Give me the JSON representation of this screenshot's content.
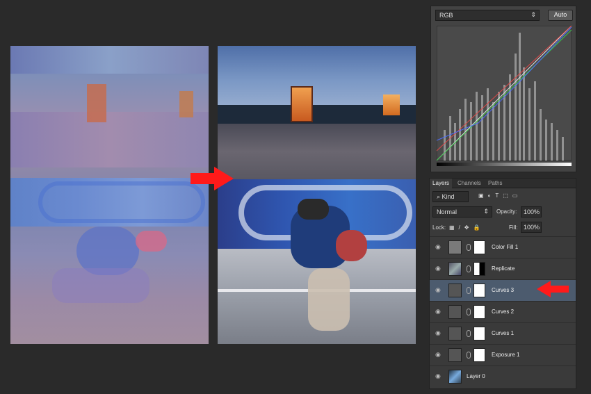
{
  "curves_panel": {
    "channel_value": "RGB",
    "auto_label": "Auto"
  },
  "layers_panel": {
    "tabs": [
      {
        "label": "Layers"
      },
      {
        "label": "Channels"
      },
      {
        "label": "Paths"
      }
    ],
    "filter_kind": "Kind",
    "blend_mode": "Normal",
    "opacity_label": "Opacity:",
    "opacity_value": "100%",
    "lock_label": "Lock:",
    "fill_label": "Fill:",
    "fill_value": "100%",
    "layers": [
      {
        "name": "Color Fill 1"
      },
      {
        "name": "Replicate"
      },
      {
        "name": "Curves 3"
      },
      {
        "name": "Curves 2"
      },
      {
        "name": "Curves 1"
      },
      {
        "name": "Exposure 1"
      },
      {
        "name": "Layer 0"
      }
    ]
  },
  "colors": {
    "accent_arrow": "#ff1a1a",
    "selected_row": "#4c5b6e"
  },
  "icons": [
    "eye-icon",
    "chain-icon",
    "arrow-right-icon",
    "arrow-left-icon",
    "lock-icon"
  ]
}
